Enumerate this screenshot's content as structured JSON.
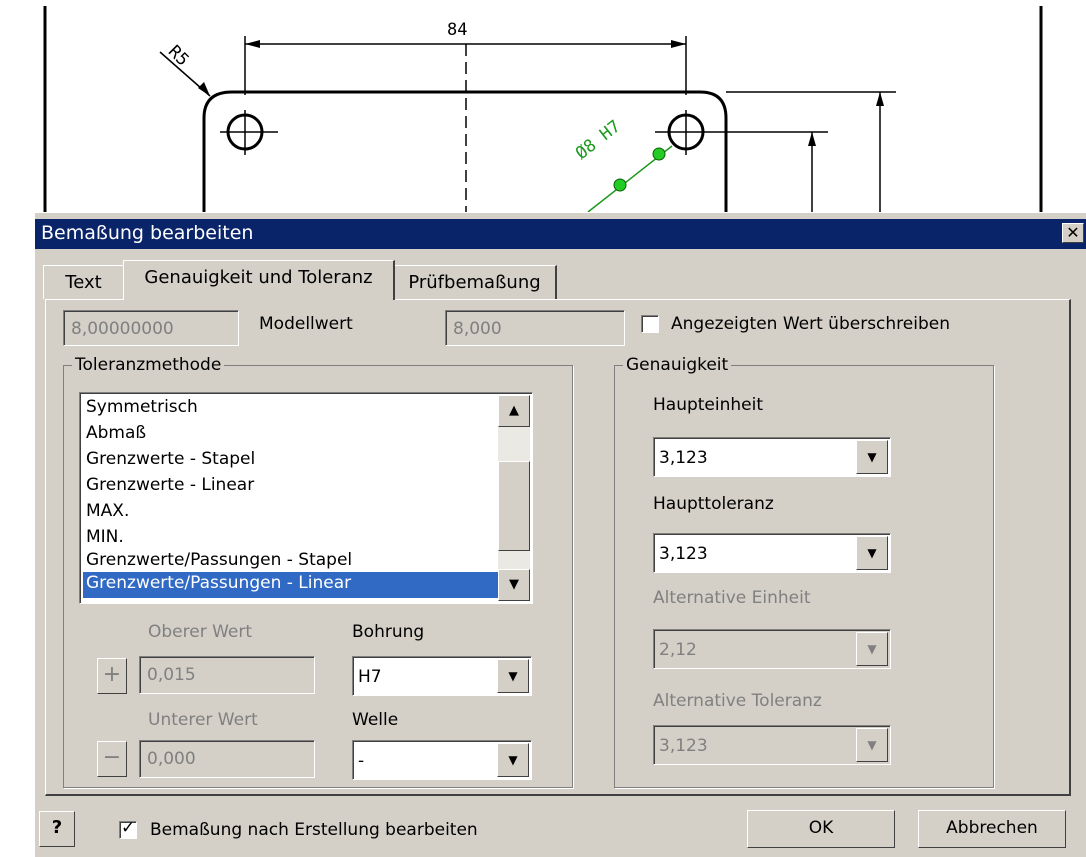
{
  "drawing": {
    "dim_84": "84",
    "radius_label": "R5",
    "hole_label": "Ø8 H7"
  },
  "dialog": {
    "title": "Bemaßung bearbeiten",
    "close_symbol": "✕",
    "tabs": [
      {
        "label": "Text",
        "active": false
      },
      {
        "label": "Genauigkeit und Toleranz",
        "active": true
      },
      {
        "label": "Prüfbemaßung",
        "active": false
      }
    ],
    "model_value_field": "8,00000000",
    "model_value_label": "Modellwert",
    "displayed_value_field": "8,000",
    "override_label": "Angezeigten Wert überschreiben",
    "override_checked": false,
    "tolerance_method": {
      "title": "Toleranzmethode",
      "items": [
        "Symmetrisch",
        "Abmaß",
        "Grenzwerte - Stapel",
        "Grenzwerte - Linear",
        "MAX.",
        "MIN.",
        "Grenzwerte/Passungen - Stapel",
        "Grenzwerte/Passungen - Linear"
      ],
      "selected_index": 7,
      "upper_label": "Oberer Wert",
      "upper_value": "0,015",
      "plus_symbol": "+",
      "lower_label": "Unterer Wert",
      "lower_value": "0,000",
      "minus_symbol": "−",
      "bore_label": "Bohrung",
      "bore_value": "H7",
      "shaft_label": "Welle",
      "shaft_value": "-"
    },
    "precision": {
      "title": "Genauigkeit",
      "primary_unit_label": "Haupteinheit",
      "primary_unit_value": "3,123",
      "primary_tol_label": "Haupttoleranz",
      "primary_tol_value": "3,123",
      "alt_unit_label": "Alternative Einheit",
      "alt_unit_value": "2,12",
      "alt_tol_label": "Alternative Toleranz",
      "alt_tol_value": "3,123"
    },
    "help_symbol": "?",
    "edit_after_create_label": "Bemaßung nach Erstellung bearbeiten",
    "edit_after_create_checked": true,
    "ok_label": "OK",
    "cancel_label": "Abbrechen"
  }
}
